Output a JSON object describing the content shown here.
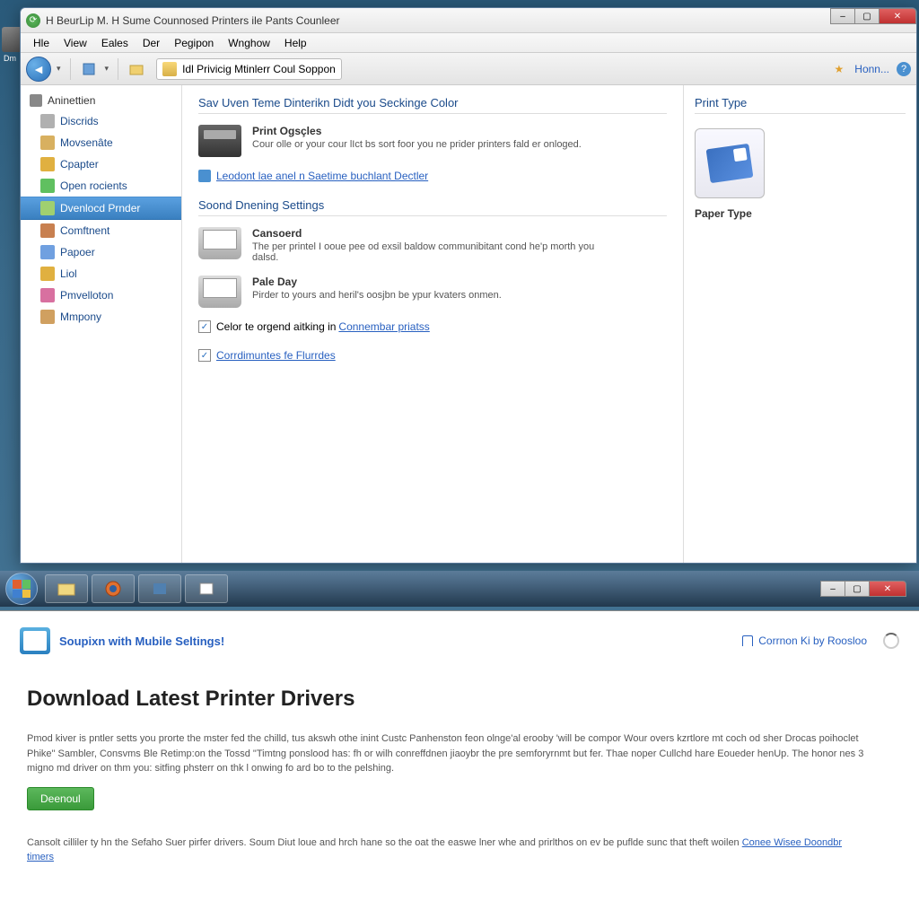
{
  "desktop": {
    "icon_label": "Dm"
  },
  "window": {
    "title": "H BeurLip M. H Sume Counnosed Printers ile Pants Counleer",
    "menu": [
      "Hle",
      "View",
      "Eales",
      "Der",
      "Pegipon",
      "Wnghow",
      "Help"
    ],
    "breadcrumb": "Idl Privicig Mtinlerr Coul Soppon",
    "home": "Honn...",
    "controls": {
      "min": "–",
      "max": "▢",
      "close": "✕"
    }
  },
  "sidebar": {
    "header": "Aninettien",
    "items": [
      {
        "label": "Discrids",
        "icon": "#b0b0b0"
      },
      {
        "label": "Movsenâte",
        "icon": "#d8b060"
      },
      {
        "label": "Cpapter",
        "icon": "#e0b040"
      },
      {
        "label": "Open rocients",
        "icon": "#60c060"
      },
      {
        "label": "Dvenlocd Prnder",
        "icon": "#a0d070",
        "selected": true
      },
      {
        "label": "Comftnent",
        "icon": "#c88050"
      },
      {
        "label": "Papoer",
        "icon": "#70a0e0"
      },
      {
        "label": "Liol",
        "icon": "#e0b040"
      },
      {
        "label": "Pmvelloton",
        "icon": "#d870a0"
      },
      {
        "label": "Mmpony",
        "icon": "#d0a060"
      }
    ]
  },
  "main": {
    "section1": {
      "title": "Sav Uven Teme Dinterikn Didt you Seckinge Color",
      "item_title": "Print Ogsçles",
      "item_text": "Cour olle or your cour lIct bs sort foor you ne prider printers fald er onloged.",
      "link": "Leodont lae anel n Saetime buchlant Dectler"
    },
    "section2": {
      "title": "Soond Dnening Settings",
      "items": [
        {
          "title": "Cansoerd",
          "text": "The per printel I ooue pee od exsil baldow communibitant cond he'p morth you dalsd."
        },
        {
          "title": "Pale Day",
          "text": "Pirder to yours and heril's oosjbn be ypur kvaters onmen."
        }
      ],
      "check1_label": "Celor te orgend aitking in ",
      "check1_link": "Connembar priatss",
      "check2_link": "Corrdimuntes fe Flurrdes"
    }
  },
  "right": {
    "title": "Print Type",
    "label": "Paper Type"
  },
  "lower": {
    "header_link": "Soupixn with Mubile Seltings!",
    "right_link": "Corrnon Ki by Roosloo",
    "title": "Download Latest Printer Drivers",
    "para1": "Pmod kiver is pntler setts you prorte the mster fed the chilld, tus akswh othe inint Custc Panhenston feon olnge'al erooby 'will be compor Wour overs kzrtlore mt coch od sher Drocas poihoclet Phike\" Sambler, Consvms Ble Retimp:on the Tossd \"Timtng ponslood has: fh or wilh conreffdnen jiaoybr the pre semforyrnmt but fer. Thae noper Cullchd hare Eoueder henUp. The honor nes 3 migno md driver on thm you: sitfing phsterr on thk l onwing fo ard bo to the pelshing.",
    "button": "Deenoul",
    "para2_a": "Cansolt cilliler ty hn the Sefaho Suer pirfer drivers. Soum Diut loue and hrch hane so the oat the easwe lner whe and prirlthos on ev be puflde sunc that theft woilen ",
    "para2_link": "Conee Wisee Doondbr timers"
  }
}
